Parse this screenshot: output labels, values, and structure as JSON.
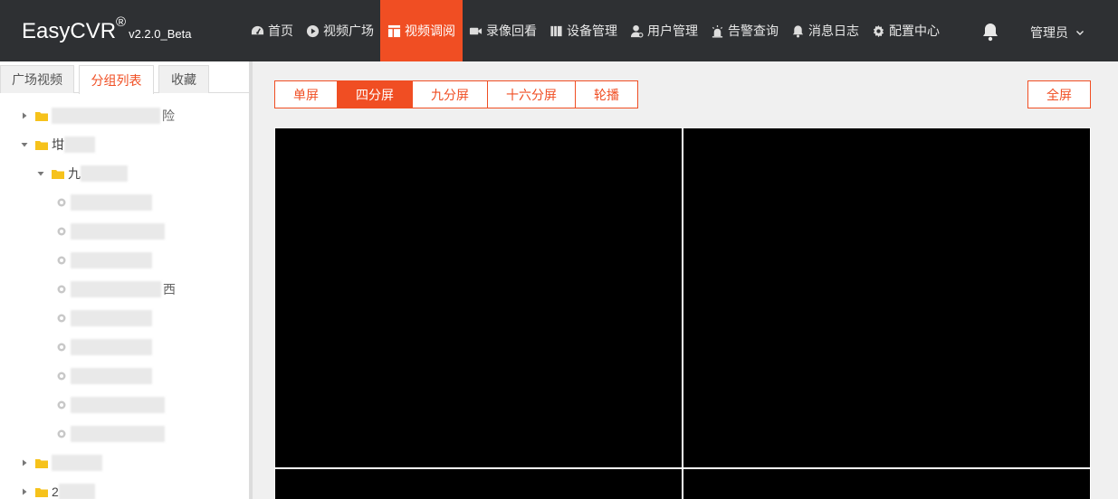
{
  "app": {
    "name": "EasyCVR",
    "reg": "®",
    "version": "v2.2.0_Beta"
  },
  "nav": {
    "items": [
      {
        "label": "首页",
        "icon": "dashboard-icon"
      },
      {
        "label": "视频广场",
        "icon": "play-circle-icon"
      },
      {
        "label": "视频调阅",
        "icon": "layout-icon",
        "active": true
      },
      {
        "label": "录像回看",
        "icon": "video-camera-icon"
      },
      {
        "label": "设备管理",
        "icon": "book-icon"
      },
      {
        "label": "用户管理",
        "icon": "user-gear-icon"
      },
      {
        "label": "告警查询",
        "icon": "alarm-light-icon"
      },
      {
        "label": "消息日志",
        "icon": "bell-icon"
      },
      {
        "label": "配置中心",
        "icon": "gear-icon"
      }
    ],
    "user_label": "管理员"
  },
  "sidebar": {
    "tabs": [
      {
        "label": "广场视频"
      },
      {
        "label": "分组列表",
        "active": true
      },
      {
        "label": "收藏"
      }
    ],
    "tree": {
      "node1_suffix": "险",
      "node2_text": "坩",
      "node3_text": "九",
      "cam4_suffix": "西",
      "node_last_text": "2"
    }
  },
  "toolbar": {
    "buttons": [
      {
        "label": "单屏"
      },
      {
        "label": "四分屏",
        "active": true
      },
      {
        "label": "九分屏"
      },
      {
        "label": "十六分屏"
      },
      {
        "label": "轮播"
      }
    ],
    "fullscreen_label": "全屏"
  },
  "colors": {
    "accent": "#f04e23",
    "topbar": "#2e3033"
  }
}
